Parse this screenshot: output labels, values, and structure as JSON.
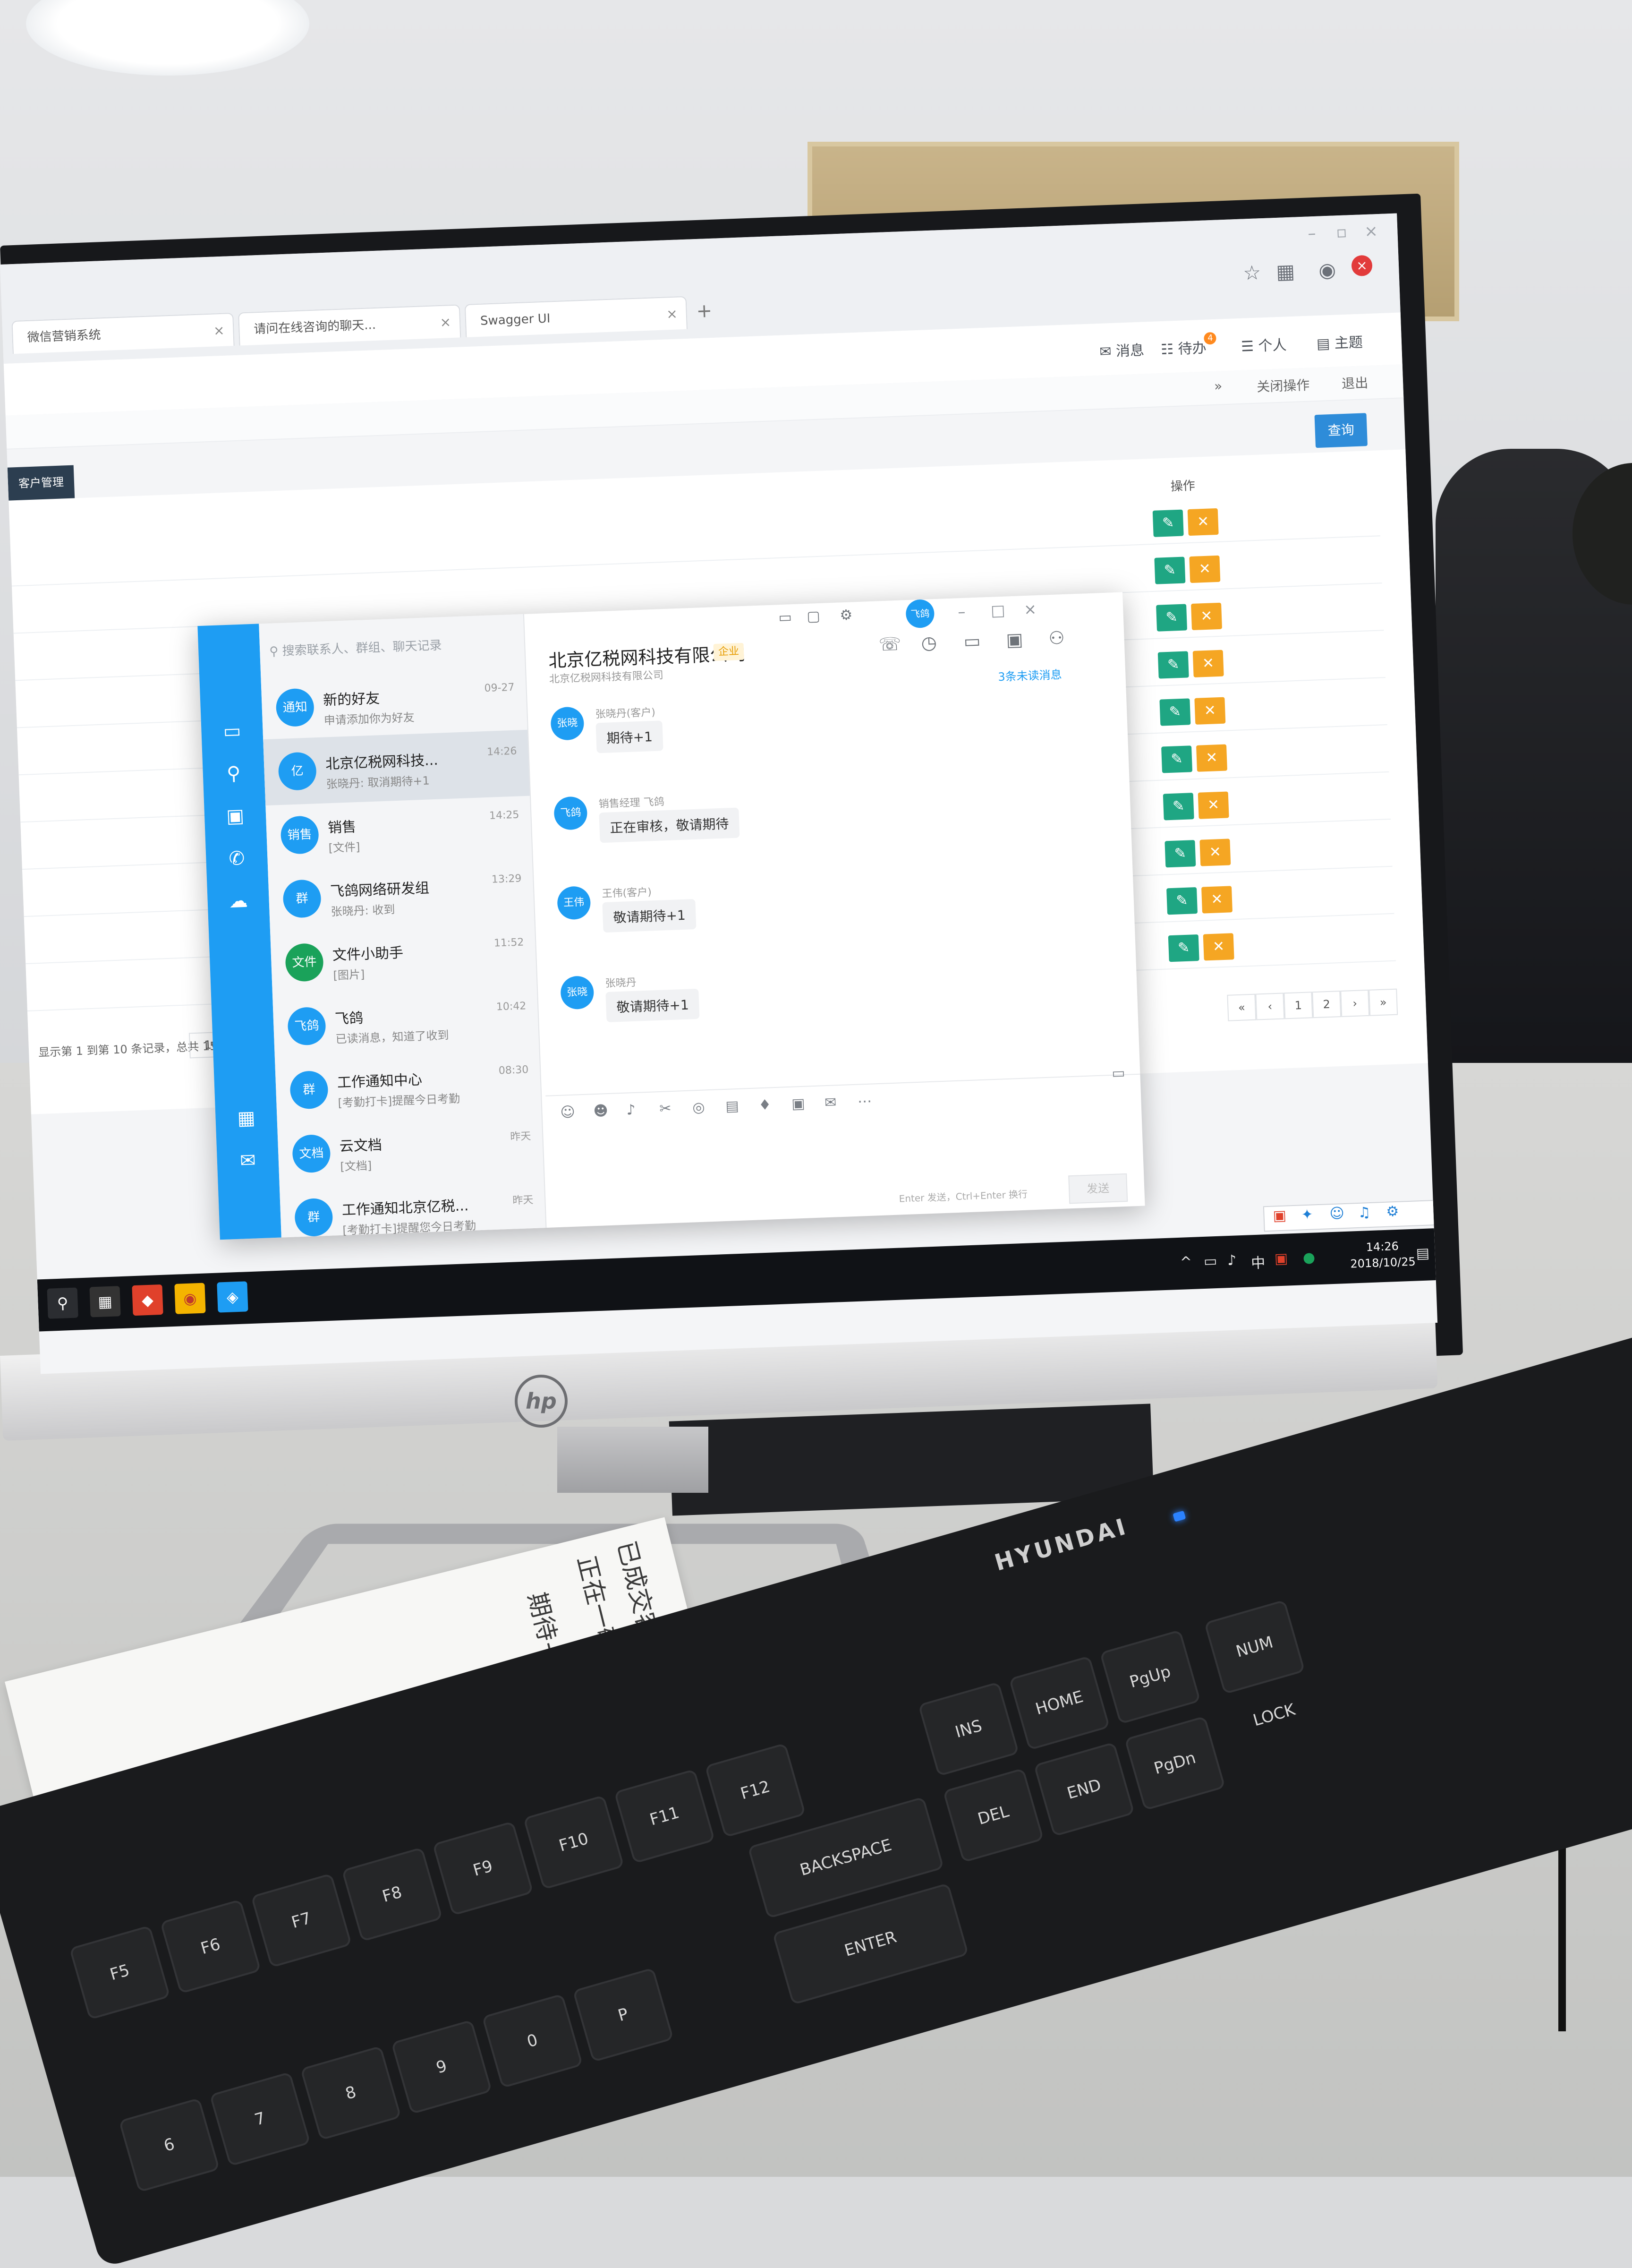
{
  "browser": {
    "tabs": [
      {
        "label": "微信营销系统"
      },
      {
        "label": "请问在线咨询的聊天..."
      },
      {
        "label": "Swagger UI"
      }
    ],
    "new_tab": "+"
  },
  "app_nav": {
    "items": [
      {
        "label": "消息"
      },
      {
        "label": "待办",
        "badge": "4"
      },
      {
        "label": "个人"
      },
      {
        "label": "主题"
      }
    ],
    "subnav": [
      "关闭操作",
      "退出"
    ]
  },
  "page": {
    "tab_label": "客户管理",
    "search_button": "查询",
    "operation_header": "操作",
    "rows_count_visible": 10,
    "pager": {
      "info": "显示第 1 到第 10 条记录，总共 15 条记录 每页显示",
      "page_size": "10",
      "buttons": [
        "«",
        "‹",
        "1",
        "2",
        "›",
        "»"
      ]
    },
    "row_actions": {
      "edit": "✎",
      "delete": "✕"
    }
  },
  "im": {
    "search_placeholder": "搜索联系人、群组、聊天记录",
    "header_avatar": "飞鸽",
    "conversations": [
      {
        "avatar": "通知",
        "name": "新的好友",
        "preview": "申请添加你为好友",
        "time": "09-27",
        "active": false
      },
      {
        "avatar": "亿",
        "name": "北京亿税网科技...",
        "preview": "张晓丹: 取消期待+1",
        "time": "14:26",
        "active": true
      },
      {
        "avatar": "销售",
        "name": "销售",
        "preview": "[文件]",
        "time": "14:25",
        "active": false
      },
      {
        "avatar": "群",
        "name": "飞鸽网络研发组",
        "preview": "张晓丹: 收到",
        "time": "13:29",
        "active": false
      },
      {
        "avatar": "文件",
        "name": "文件小助手",
        "preview": "[图片]",
        "time": "11:52",
        "active": false,
        "green": true
      },
      {
        "avatar": "飞鸽",
        "name": "飞鸽",
        "preview": "已读消息，知道了收到",
        "time": "10:42",
        "active": false
      },
      {
        "avatar": "群",
        "name": "工作通知中心",
        "preview": "[考勤打卡]提醒今日考勤",
        "time": "08:30",
        "active": false
      },
      {
        "avatar": "文档",
        "name": "云文档",
        "preview": "[文档]",
        "time": "昨天",
        "active": false
      },
      {
        "avatar": "群",
        "name": "工作通知北京亿税...",
        "preview": "[考勤打卡]提醒您今日考勤",
        "time": "昨天",
        "active": false
      }
    ],
    "chat": {
      "title": "北京亿税网科技有限公司",
      "tag": "企业",
      "subtitle": "北京亿税网科技有限公司",
      "unread_link": "3条未读消息",
      "messages": [
        {
          "avatar": "张晓",
          "sender": "张晓丹(客户)",
          "text": "期待+1"
        },
        {
          "avatar": "飞鸽",
          "sender": "销售经理 飞鸽",
          "text": "正在审核，敬请期待"
        },
        {
          "avatar": "王伟",
          "sender": "王伟(客户)",
          "text": "敬请期待+1"
        },
        {
          "avatar": "张晓",
          "sender": "张晓丹",
          "text": "敬请期待+1"
        }
      ],
      "compose_hint": "Enter 发送，Ctrl+Enter 换行",
      "send_label": "发送"
    }
  },
  "taskbar": {
    "time": "14:26",
    "date": "2018/10/25"
  },
  "monitor_brand": "hp",
  "keyboard": {
    "brand": "HYUNDAI",
    "keys": [
      "F5",
      "F6",
      "F7",
      "F8",
      "F9",
      "F10",
      "F11",
      "F12",
      "INS",
      "HOME",
      "PgUp",
      "NUM LOCK",
      "BACKSPACE",
      "DEL",
      "END",
      "PgDn",
      "ENTER",
      "P",
      "0",
      "9",
      "8",
      "7",
      "6"
    ]
  },
  "paper_note": {
    "lines": [
      "已成交客户",
      "正在一敬请期待",
      "期待+1"
    ]
  },
  "colors": {
    "im_blue": "#1e9df3",
    "edit_green": "#1fa683",
    "delete_orange": "#f5a623",
    "primary_button": "#2e8cd9"
  }
}
